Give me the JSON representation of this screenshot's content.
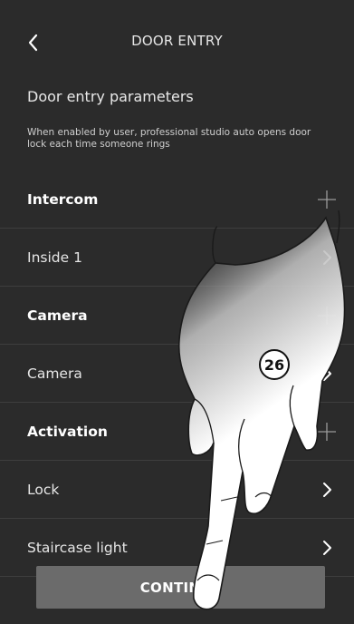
{
  "header": {
    "title": "DOOR ENTRY",
    "back_icon": "chevron-left-icon"
  },
  "section": {
    "title": "Door entry parameters",
    "description": "When enabled by user, professional studio auto opens door lock each time someone rings"
  },
  "rows": [
    {
      "label": "Intercom",
      "type": "group",
      "icon": "plus-icon"
    },
    {
      "label": "Inside 1",
      "type": "item",
      "icon": "chevron-right-icon"
    },
    {
      "label": "Camera",
      "type": "group",
      "icon": "plus-icon"
    },
    {
      "label": "Camera",
      "type": "item",
      "icon": "chevron-right-icon"
    },
    {
      "label": "Activation",
      "type": "group",
      "icon": "plus-icon"
    },
    {
      "label": "Lock",
      "type": "item",
      "icon": "chevron-right-icon"
    },
    {
      "label": "Staircase light",
      "type": "item",
      "icon": "chevron-right-icon"
    }
  ],
  "footer": {
    "continue_label": "CONTINUE"
  },
  "annotation": {
    "step_number": "26"
  },
  "colors": {
    "background": "#2b2b2b",
    "divider": "#3e3e3e",
    "button": "#6b6b6b",
    "text": "#ffffff"
  }
}
